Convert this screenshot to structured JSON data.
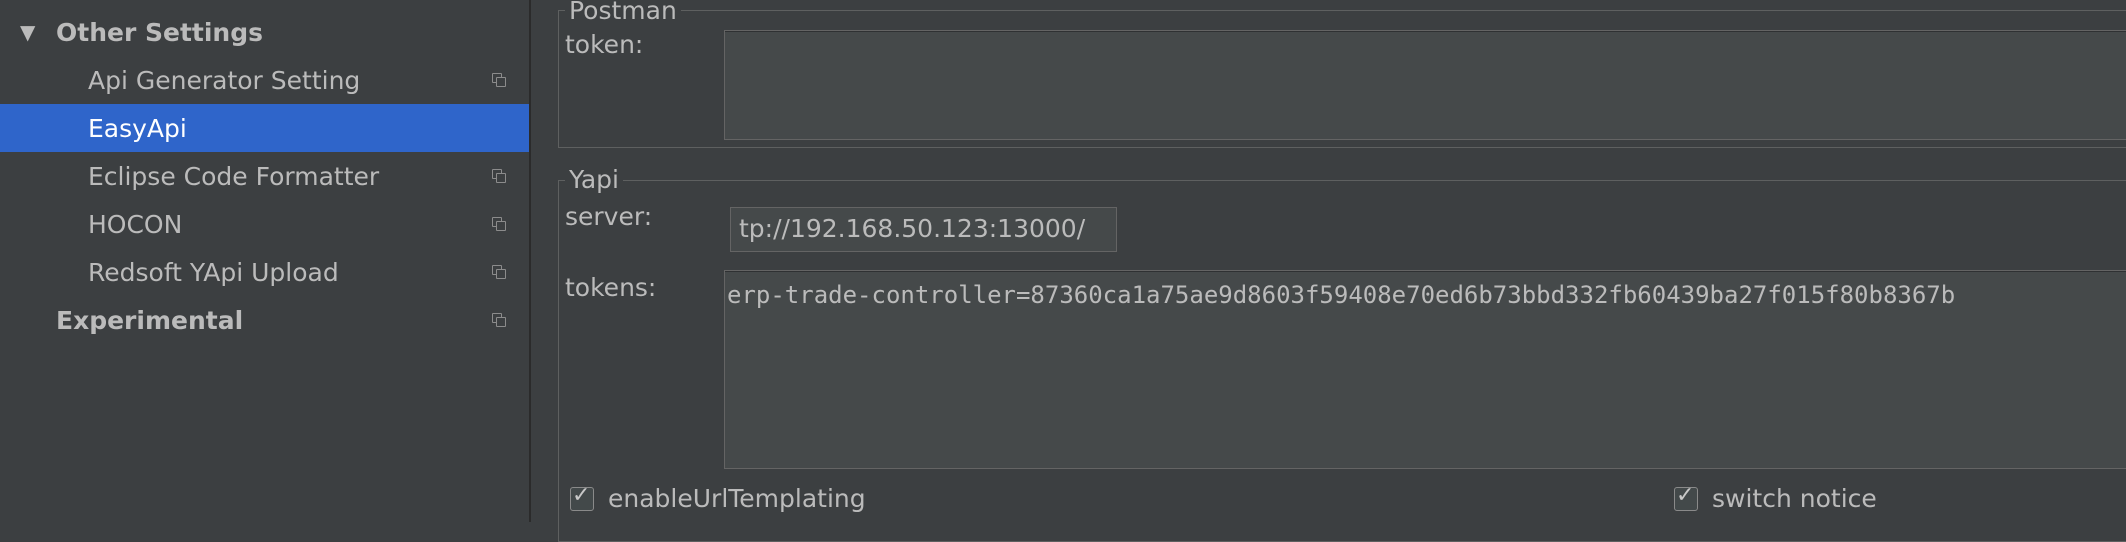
{
  "sidebar": {
    "items": [
      {
        "label": "Other Settings",
        "level": "top",
        "expanded": true,
        "has_copy_icon": false
      },
      {
        "label": "Api Generator Setting",
        "level": "sub",
        "has_copy_icon": true
      },
      {
        "label": "EasyApi",
        "level": "sub",
        "selected": true,
        "has_copy_icon": false
      },
      {
        "label": "Eclipse Code Formatter",
        "level": "sub",
        "has_copy_icon": true
      },
      {
        "label": "HOCON",
        "level": "sub",
        "has_copy_icon": true
      },
      {
        "label": "Redsoft YApi Upload",
        "level": "sub",
        "has_copy_icon": true
      },
      {
        "label": "Experimental",
        "level": "top",
        "has_copy_icon": true
      }
    ]
  },
  "postman": {
    "title": "Postman",
    "token_label": "token:",
    "token_value": ""
  },
  "yapi": {
    "title": "Yapi",
    "server_label": "server:",
    "server_value": "tp://192.168.50.123:13000/",
    "tokens_label": "tokens:",
    "tokens_value": "erp-trade-controller=87360ca1a75ae9d8603f59408e70ed6b73bbd332fb60439ba27f015f80b8367b"
  },
  "options": {
    "enable_url_templating": {
      "label": "enableUrlTemplating",
      "checked": true
    },
    "switch_notice": {
      "label": "switch notice",
      "checked": true
    }
  },
  "colors": {
    "background": "#3c3f41",
    "selection": "#2f65ca",
    "text": "#bbbbbb",
    "input_background": "#45494a"
  }
}
